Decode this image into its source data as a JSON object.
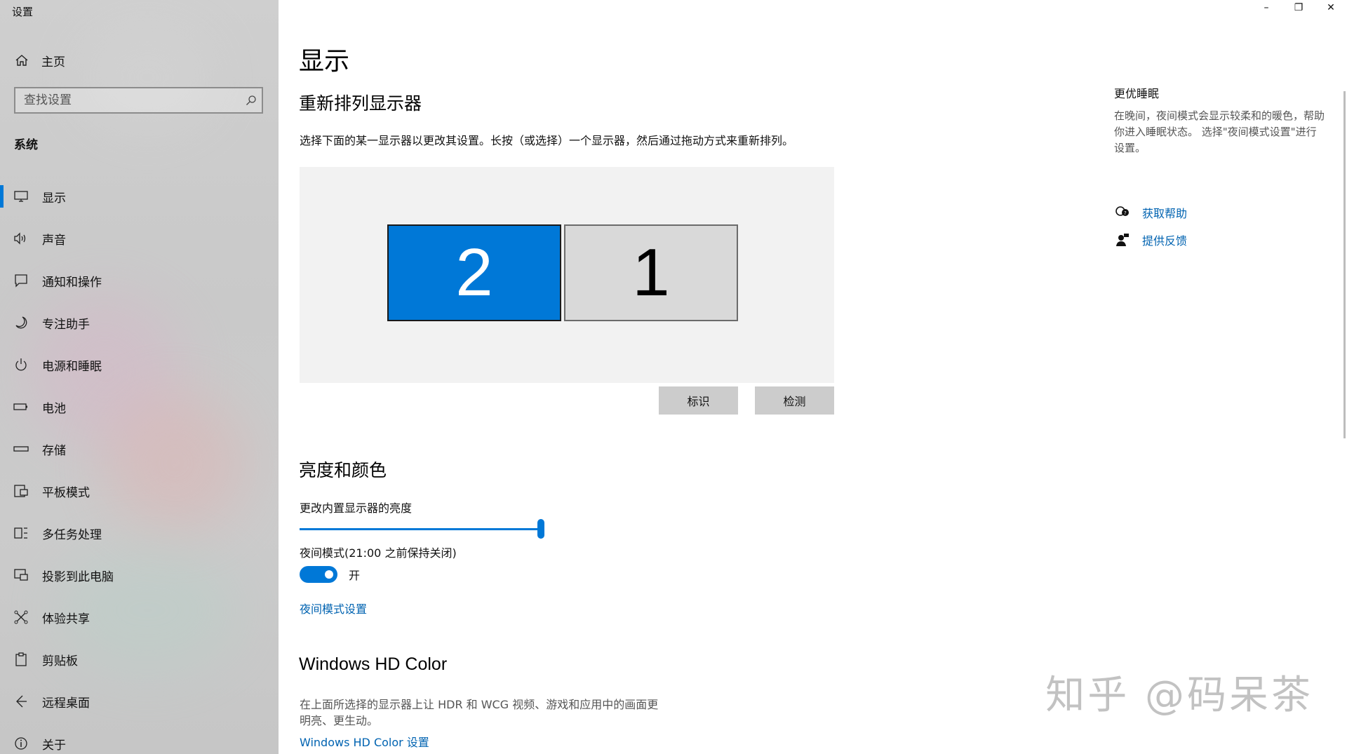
{
  "app": {
    "title": "设置"
  },
  "sidebar": {
    "home_label": "主页",
    "search_placeholder": "查找设置",
    "section": "系统",
    "items": [
      {
        "label": "显示",
        "icon": "monitor-icon",
        "active": true
      },
      {
        "label": "声音",
        "icon": "speaker-icon"
      },
      {
        "label": "通知和操作",
        "icon": "notification-icon"
      },
      {
        "label": "专注助手",
        "icon": "moon-icon"
      },
      {
        "label": "电源和睡眠",
        "icon": "power-icon"
      },
      {
        "label": "电池",
        "icon": "battery-icon"
      },
      {
        "label": "存储",
        "icon": "storage-icon"
      },
      {
        "label": "平板模式",
        "icon": "tablet-icon"
      },
      {
        "label": "多任务处理",
        "icon": "multitask-icon"
      },
      {
        "label": "投影到此电脑",
        "icon": "project-icon"
      },
      {
        "label": "体验共享",
        "icon": "share-icon"
      },
      {
        "label": "剪贴板",
        "icon": "clipboard-icon"
      },
      {
        "label": "远程桌面",
        "icon": "remote-icon"
      },
      {
        "label": "关于",
        "icon": "info-icon"
      }
    ]
  },
  "window": {
    "minimize": "–",
    "restore": "❐",
    "close": "✕"
  },
  "main": {
    "title": "显示",
    "rearrange": {
      "heading": "重新排列显示器",
      "description": "选择下面的某一显示器以更改其设置。长按（或选择）一个显示器，然后通过拖动方式来重新排列。",
      "monitors": [
        "2",
        "1"
      ],
      "identify_button": "标识",
      "detect_button": "检测"
    },
    "brightness": {
      "heading": "亮度和颜色",
      "slider_label": "更改内置显示器的亮度",
      "slider_value": 100,
      "night_label": "夜间模式(21:00 之前保持关闭)",
      "toggle_state": "开",
      "night_settings_link": "夜间模式设置"
    },
    "hdr": {
      "heading": "Windows HD Color",
      "description_line1": "在上面所选择的显示器上让 HDR 和 WCG 视频、游戏和应用中的画面更",
      "description_line2": "明亮、更生动。",
      "link": "Windows HD Color 设置"
    }
  },
  "side_panel": {
    "title": "更优睡眠",
    "description": "在晚间，夜间模式会显示较柔和的暖色，帮助你进入睡眠状态。 选择\"夜间模式设置\"进行设置。",
    "help_link": "获取帮助",
    "feedback_link": "提供反馈"
  },
  "watermark": "知乎 @码呆茶",
  "colors": {
    "accent": "#0078d7",
    "link": "#0063b1"
  }
}
